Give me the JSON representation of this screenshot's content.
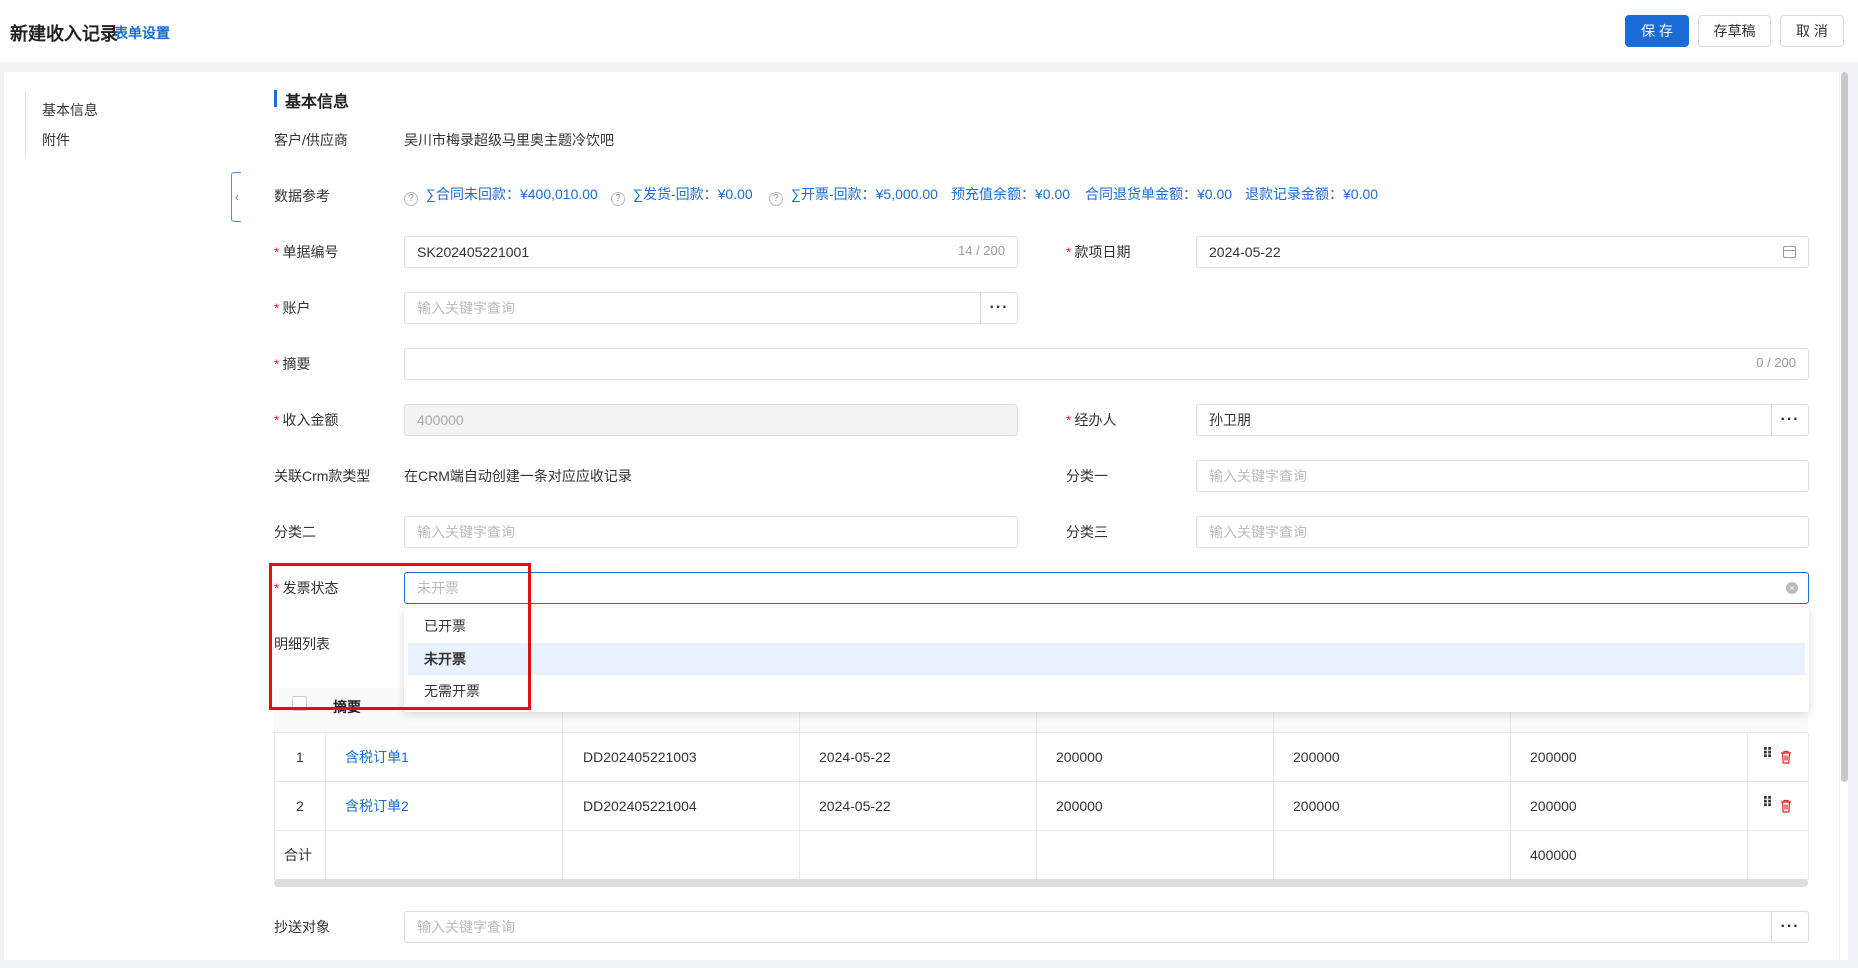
{
  "header": {
    "title": "新建收入记录",
    "form_setting": "表单设置",
    "save": "保 存",
    "draft": "存草稿",
    "cancel": "取 消"
  },
  "sidebar": {
    "items": [
      {
        "label": "基本信息"
      },
      {
        "label": "附件"
      }
    ]
  },
  "section": {
    "title": "基本信息"
  },
  "fields": {
    "customer_label": "客户/供应商",
    "customer_value": "吴川市梅录超级马里奥主题冷饮吧",
    "ref_label": "数据参考",
    "refs": [
      "∑合同未回款：¥400,010.00",
      "∑发货-回款：¥0.00",
      "∑开票-回款：¥5,000.00",
      "预充值余额：¥0.00",
      "合同退货单金额：¥0.00",
      "退款记录金额：¥0.00"
    ],
    "doc_no_label": "单据编号",
    "doc_no_value": "SK202405221001",
    "doc_no_counter": "14 / 200",
    "date_label": "款项日期",
    "date_value": "2024-05-22",
    "account_label": "账户",
    "account_placeholder": "输入关键字查询",
    "summary_label": "摘要",
    "summary_counter": "0 / 200",
    "amount_label": "收入金额",
    "amount_value": "400000",
    "handler_label": "经办人",
    "handler_value": "孙卫朋",
    "crm_label": "关联Crm款类型",
    "crm_value": "在CRM端自动创建一条对应应收记录",
    "cat1_label": "分类一",
    "cat1_placeholder": "输入关键字查询",
    "cat2_label": "分类二",
    "cat2_placeholder": "输入关键字查询",
    "cat3_label": "分类三",
    "cat3_placeholder": "输入关键字查询",
    "invoice_label": "发票状态",
    "invoice_placeholder": "未开票",
    "detail_label": "明细列表",
    "cc_label": "抄送对象",
    "cc_placeholder": "输入关键字查询"
  },
  "invoice_dropdown": {
    "options": [
      "已开票",
      "未开票",
      "无需开票"
    ],
    "selected": "未开票"
  },
  "table": {
    "header_summary": "摘要",
    "rows": [
      {
        "no": "1",
        "summary": "含税订单1",
        "order": "DD202405221003",
        "date": "2024-05-22",
        "a": "200000",
        "b": "200000",
        "c": "200000"
      },
      {
        "no": "2",
        "summary": "含税订单2",
        "order": "DD202405221004",
        "date": "2024-05-22",
        "a": "200000",
        "b": "200000",
        "c": "200000"
      }
    ],
    "total_label": "合计",
    "total_value": "400000"
  },
  "colors": {
    "accent": "#1a6dd6",
    "required": "#e02424",
    "highlight": "#e01010"
  }
}
